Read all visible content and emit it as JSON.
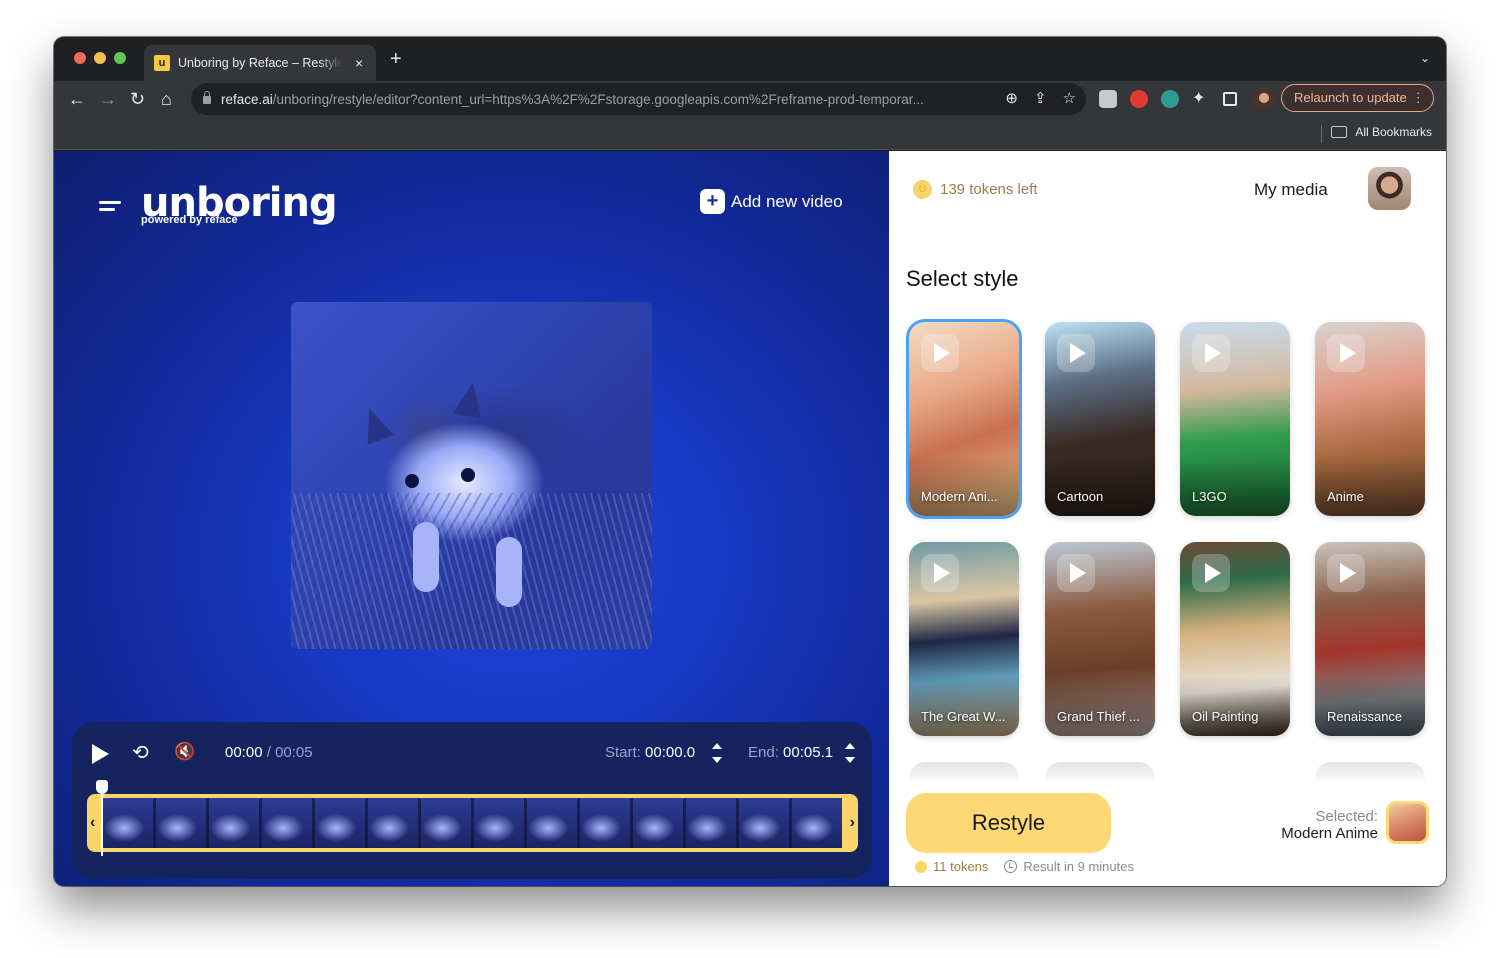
{
  "browser": {
    "tab": {
      "favicon_text": "u",
      "title": "Unboring by Reface – Restyle",
      "close_icon": "×"
    },
    "new_tab_icon": "+",
    "tab_menu_icon": "⌄",
    "url_host": "reface.ai",
    "url_path": "/unboring/restyle/editor?content_url=https%3A%2F%2Fstorage.googleapis.com%2Freframe-prod-temporar...",
    "nav": {
      "back": "←",
      "forward": "→",
      "reload": "↻",
      "home": "⌂"
    },
    "omnibox_icons": {
      "zoom": "⊕",
      "share": "⇪",
      "bookmark": "☆"
    },
    "relaunch_label": "Relaunch to update",
    "relaunch_menu": "⋮",
    "bookmarks_label": "All Bookmarks"
  },
  "editor": {
    "logo": "unboring",
    "logo_sub": "powered by reface",
    "add_video_icon": "+",
    "add_video_label": "Add new video",
    "player": {
      "current_time": "00:00",
      "separator": " / ",
      "duration": "00:05",
      "start_label": "Start:",
      "start_value": "00:00.0",
      "end_label": "End:",
      "end_value": "00:05.1",
      "loop_icon": "⟲",
      "mute_icon": "🔇",
      "trim_left": "‹",
      "trim_right": "›"
    }
  },
  "panel": {
    "tokens_left": "139 tokens left",
    "coin_glyph": "U",
    "my_media": "My media",
    "select_style_title": "Select style",
    "styles": [
      {
        "label": "Modern Ani...",
        "selected": true
      },
      {
        "label": "Cartoon",
        "selected": false
      },
      {
        "label": "L3GO",
        "selected": false
      },
      {
        "label": "Anime",
        "selected": false
      },
      {
        "label": "The Great W...",
        "selected": false
      },
      {
        "label": "Grand Thief ...",
        "selected": false
      },
      {
        "label": "Oil Painting",
        "selected": false
      },
      {
        "label": "Renaissance",
        "selected": false
      }
    ],
    "restyle_label": "Restyle",
    "cost": "11 tokens",
    "eta": "Result in 9 minutes",
    "selected_label": "Selected:",
    "selected_value": "Modern Anime"
  },
  "colors": {
    "accent_yellow": "#fcd975",
    "selected_outline": "#4aa3f2",
    "editor_blue": "#1738c0",
    "token_text": "#9c7d4a"
  }
}
